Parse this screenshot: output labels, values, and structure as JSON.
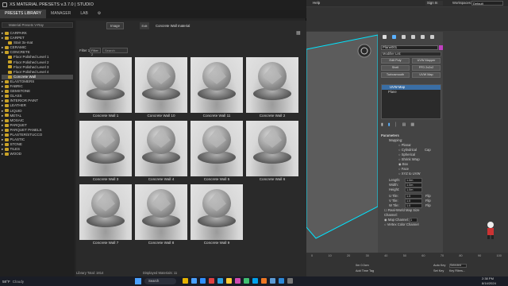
{
  "app": {
    "title": "XS MATERIAL PRESETS v.3.7.0 | STUDIO"
  },
  "menu": {
    "tabs": [
      "PRESETS LIBRARY",
      "MANAGER",
      "LAB"
    ]
  },
  "toolbar": {
    "search_placeholder": "Material Presets V-Ray",
    "btn_image": "Image",
    "btn_edit": "Edit",
    "current_material": "Concrete Wall material"
  },
  "filter": {
    "label": "Filter 1",
    "filter2": "Filter 2",
    "search": "Search"
  },
  "tree": [
    {
      "label": "CARPARK",
      "kind": "folder"
    },
    {
      "label": "CARPET",
      "kind": "folder"
    },
    {
      "label": "Stair 3x-mat",
      "kind": "item"
    },
    {
      "label": "CERAMIC",
      "kind": "folder"
    },
    {
      "label": "CONCRETE",
      "kind": "folder"
    },
    {
      "label": "Floor Polished Level 1",
      "kind": "item"
    },
    {
      "label": "Floor Polished Level 2",
      "kind": "item"
    },
    {
      "label": "Floor Polished Level 3",
      "kind": "item"
    },
    {
      "label": "Floor Polished Level 4",
      "kind": "item"
    },
    {
      "label": "Concrete Wall",
      "kind": "selected"
    },
    {
      "label": "ELASTOMERS",
      "kind": "folder"
    },
    {
      "label": "FABRIC",
      "kind": "folder"
    },
    {
      "label": "GEMSTONE",
      "kind": "folder"
    },
    {
      "label": "GLASS",
      "kind": "folder"
    },
    {
      "label": "INTERIOR PAINT",
      "kind": "folder"
    },
    {
      "label": "LEATHER",
      "kind": "folder"
    },
    {
      "label": "LIQUID",
      "kind": "folder"
    },
    {
      "label": "METAL",
      "kind": "folder"
    },
    {
      "label": "MOSAIC",
      "kind": "folder"
    },
    {
      "label": "PARQUET",
      "kind": "folder"
    },
    {
      "label": "PARQUET PANELS",
      "kind": "folder"
    },
    {
      "label": "PLASTER/STUCCO",
      "kind": "folder"
    },
    {
      "label": "PLASTIC",
      "kind": "folder"
    },
    {
      "label": "STONE",
      "kind": "folder"
    },
    {
      "label": "TILES",
      "kind": "folder"
    },
    {
      "label": "WOOD",
      "kind": "folder"
    }
  ],
  "materials": [
    "Concrete Wall 1",
    "Concrete Wall 10",
    "Concrete Wall 11",
    "Concrete Wall 2",
    "Concrete Wall 3",
    "Concrete Wall 4",
    "Concrete Wall 5",
    "Concrete Wall 6",
    "Concrete Wall 7",
    "Concrete Wall 8",
    "Concrete Wall 9"
  ],
  "status": {
    "library": "Library Total: 1814",
    "displayed": "Displayed Materials: 11"
  },
  "max": {
    "menu_help": "Help",
    "signin": "Sign In",
    "workspaces": "Workspaces:",
    "workspace_value": "Default",
    "object_name": "Plane001",
    "modifier_list": "Modifier List",
    "buttons": [
      "Edit Poly",
      "UVW Mapper",
      "Shell",
      "FFD 2x2x2",
      "Turbosmooth",
      "UVW Map"
    ],
    "stack": [
      "UVW Map",
      "Plane"
    ],
    "params_title": "Parameters",
    "mapping_label": "Mapping:",
    "mappings": [
      "Planar",
      "Cylindrical",
      "Spherical",
      "Shrink Wrap",
      "Box",
      "Face",
      "XYZ to UVW"
    ],
    "cap": "Cap",
    "length_label": "Length:",
    "length_value": "1.0m",
    "width_label": "Width:",
    "width_value": "1.0m",
    "height_label": "Height:",
    "height_value": "1.0m",
    "utile_label": "U Tile:",
    "utile_value": "1.0",
    "vtile_label": "V Tile:",
    "vtile_value": "1.0",
    "wtile_label": "W Tile:",
    "wtile_value": "1.0",
    "flip": "Flip",
    "realworld": "Real-World Map Size",
    "channel_label": "Channel:",
    "map_channel": "Map Channel:",
    "map_channel_value": "1",
    "vertex_channel": "Vertex Color Channel",
    "timeline": [
      "0",
      "10",
      "20",
      "30",
      "40",
      "50",
      "60",
      "70",
      "80",
      "90",
      "100"
    ],
    "time_field": "0m 0.0cm",
    "add_time_tag": "Add Time Tag",
    "auto_key": "Auto Key",
    "set_key": "Set Key",
    "selected": "Selected",
    "key_filters": "Key Filters..."
  },
  "taskbar": {
    "weather_temp": "58°F",
    "weather_desc": "Cloudy",
    "search": "Search",
    "time": "2:38 PM",
    "date": "8/14/2024"
  },
  "colors": {
    "accent_viewport": "#00e5ff",
    "folder": "#c9a227",
    "selection": "#3a6ea5"
  }
}
